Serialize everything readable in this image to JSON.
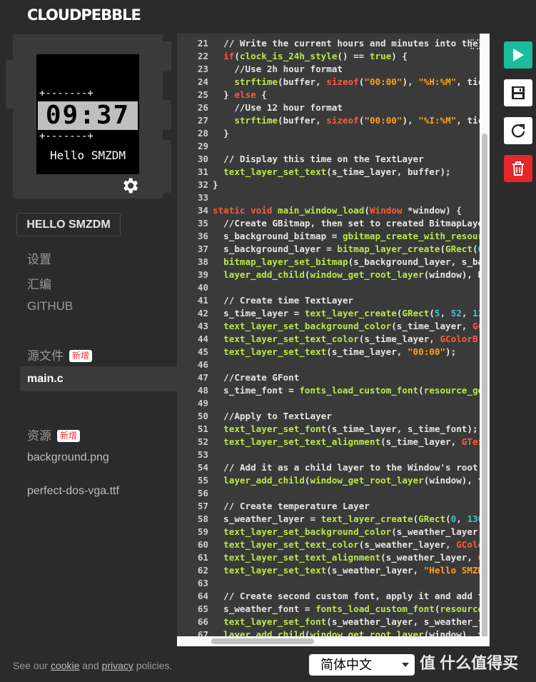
{
  "app": {
    "logo": "CLOUDPEBBLE"
  },
  "watch": {
    "dashes_top": "+-------+",
    "dashes_bottom": "+-------+",
    "time": "09:37",
    "message": "Hello SMZDM"
  },
  "sidebar": {
    "project_button": "HELLO SMZDM",
    "nav": [
      "设置",
      "汇编",
      "GITHUB"
    ],
    "source_section": "源文件",
    "source_badge": "新增",
    "source_files": [
      "main.c"
    ],
    "resources_section": "资源",
    "resources_badge": "新增",
    "resources": [
      "background.png",
      "perfect-dos-vga.ttf"
    ]
  },
  "editor": {
    "lines": [
      {
        "n": "21",
        "html": "  <span class=\"cmt\">// Write the current hours and minutes into the</span>"
      },
      {
        "n": "22",
        "html": "  <span class=\"kw\">if</span>(<span class=\"fn\">clock_is_24h_style</span>() == <span class=\"fn\">true</span>) {"
      },
      {
        "n": "23",
        "html": "    <span class=\"cmt\">//Use 2h hour format</span>"
      },
      {
        "n": "24",
        "html": "    <span class=\"fn\">strftime</span>(buffer, <span class=\"kw\">sizeof</span>(<span class=\"str\">\"00:00\"</span>), <span class=\"str\">\"%H:%M\"</span>, tic"
      },
      {
        "n": "25",
        "html": "  } <span class=\"kw\">else</span> {"
      },
      {
        "n": "26",
        "html": "    <span class=\"cmt\">//Use 12 hour format</span>"
      },
      {
        "n": "27",
        "html": "    <span class=\"fn\">strftime</span>(buffer, <span class=\"kw\">sizeof</span>(<span class=\"str\">\"00:00\"</span>), <span class=\"str\">\"%I:%M\"</span>, tic"
      },
      {
        "n": "28",
        "html": "  }"
      },
      {
        "n": "29",
        "html": ""
      },
      {
        "n": "30",
        "html": "  <span class=\"cmt\">// Display this time on the TextLayer</span>"
      },
      {
        "n": "31",
        "html": "  <span class=\"fn\">text_layer_set_text</span>(s_time_layer, buffer);"
      },
      {
        "n": "32",
        "html": "}"
      },
      {
        "n": "33",
        "html": ""
      },
      {
        "n": "34",
        "html": "<span class=\"kw\">static</span> <span class=\"kw\">void</span> <span class=\"fn\">main_window_load</span>(<span class=\"kw\">Window</span> *window) {"
      },
      {
        "n": "35",
        "html": "  <span class=\"cmt\">//Create GBitmap, then set to created BitmapLaye</span>"
      },
      {
        "n": "36",
        "html": "  s_background_bitmap = <span class=\"fn\">gbitmap_create_with_resour</span>"
      },
      {
        "n": "37",
        "html": "  s_background_layer = <span class=\"fn\">bitmap_layer_create</span>(<span class=\"fn\">GRect</span>(<span class=\"num\">0</span>"
      },
      {
        "n": "38",
        "html": "  <span class=\"fn\">bitmap_layer_set_bitmap</span>(s_background_layer, s_ba"
      },
      {
        "n": "39",
        "html": "  <span class=\"fn\">layer_add_child</span>(<span class=\"fn\">window_get_root_layer</span>(window), b"
      },
      {
        "n": "40",
        "html": ""
      },
      {
        "n": "41",
        "html": "  <span class=\"cmt\">// Create time TextLayer</span>"
      },
      {
        "n": "42",
        "html": "  s_time_layer = <span class=\"fn\">text_layer_create</span>(<span class=\"fn\">GRect</span>(<span class=\"num\">5</span>, <span class=\"num\">52</span>, <span class=\"num\">13</span>"
      },
      {
        "n": "43",
        "html": "  <span class=\"fn\">text_layer_set_background_color</span>(s_time_layer, <span class=\"kw\">GC</span>"
      },
      {
        "n": "44",
        "html": "  <span class=\"fn\">text_layer_set_text_color</span>(s_time_layer, <span class=\"kw\">GColorB</span>"
      },
      {
        "n": "45",
        "html": "  <span class=\"fn\">text_layer_set_text</span>(s_time_layer, <span class=\"str\">\"00:00\"</span>);"
      },
      {
        "n": "46",
        "html": ""
      },
      {
        "n": "47",
        "html": "  <span class=\"cmt\">//Create GFont</span>"
      },
      {
        "n": "48",
        "html": "  s_time_font = <span class=\"fn\">fonts_load_custom_font</span>(<span class=\"fn\">resource_ge</span>"
      },
      {
        "n": "49",
        "html": ""
      },
      {
        "n": "50",
        "html": "  <span class=\"cmt\">//Apply to TextLayer</span>"
      },
      {
        "n": "51",
        "html": "  <span class=\"fn\">text_layer_set_font</span>(s_time_layer, s_time_font);"
      },
      {
        "n": "52",
        "html": "  <span class=\"fn\">text_layer_set_text_alignment</span>(s_time_layer, <span class=\"kw\">GTex</span>"
      },
      {
        "n": "53",
        "html": ""
      },
      {
        "n": "54",
        "html": "  <span class=\"cmt\">// Add it as a child layer to the Window's root</span>"
      },
      {
        "n": "55",
        "html": "  <span class=\"fn\">layer_add_child</span>(<span class=\"fn\">window_get_root_layer</span>(window), t"
      },
      {
        "n": "56",
        "html": ""
      },
      {
        "n": "57",
        "html": "  <span class=\"cmt\">// Create temperature Layer</span>"
      },
      {
        "n": "58",
        "html": "  s_weather_layer = <span class=\"fn\">text_layer_create</span>(<span class=\"fn\">GRect</span>(<span class=\"num\">0</span>, <span class=\"num\">130</span>"
      },
      {
        "n": "59",
        "html": "  <span class=\"fn\">text_layer_set_background_color</span>(s_weather_layer,"
      },
      {
        "n": "60",
        "html": "  <span class=\"fn\">text_layer_set_text_color</span>(s_weather_layer, <span class=\"kw\">GColo</span>"
      },
      {
        "n": "61",
        "html": "  <span class=\"fn\">text_layer_set_text_alignment</span>(s_weather_layer, <span class=\"kw\">G</span>"
      },
      {
        "n": "62",
        "html": "  <span class=\"fn\">text_layer_set_text</span>(s_weather_layer, <span class=\"str\">\"Hello SMZD</span>"
      },
      {
        "n": "63",
        "html": ""
      },
      {
        "n": "64",
        "html": "  <span class=\"cmt\">// Create second custom font, apply it and add t</span>"
      },
      {
        "n": "65",
        "html": "  s_weather_font = <span class=\"fn\">fonts_load_custom_font</span>(<span class=\"fn\">resource</span>"
      },
      {
        "n": "66",
        "html": "  <span class=\"fn\">text_layer_set_font</span>(s_weather_layer, s_weather_f"
      },
      {
        "n": "67",
        "html": "  <span class=\"fn\">layer_add_child</span>(<span class=\"fn\">window_get_root_layer</span>(window), t"
      },
      {
        "n": "68",
        "html": ""
      }
    ]
  },
  "toolbar": {
    "run_color": "#1abc9c",
    "save_color": "#ffffff",
    "reload_color": "#ffffff",
    "delete_color": "#e5262a"
  },
  "footer": {
    "text_before": "See our ",
    "cookie": "cookie",
    "middle": " and ",
    "privacy": "privacy",
    "after": " policies.",
    "language": "简体中文",
    "watermark": "值 什么值得买"
  }
}
